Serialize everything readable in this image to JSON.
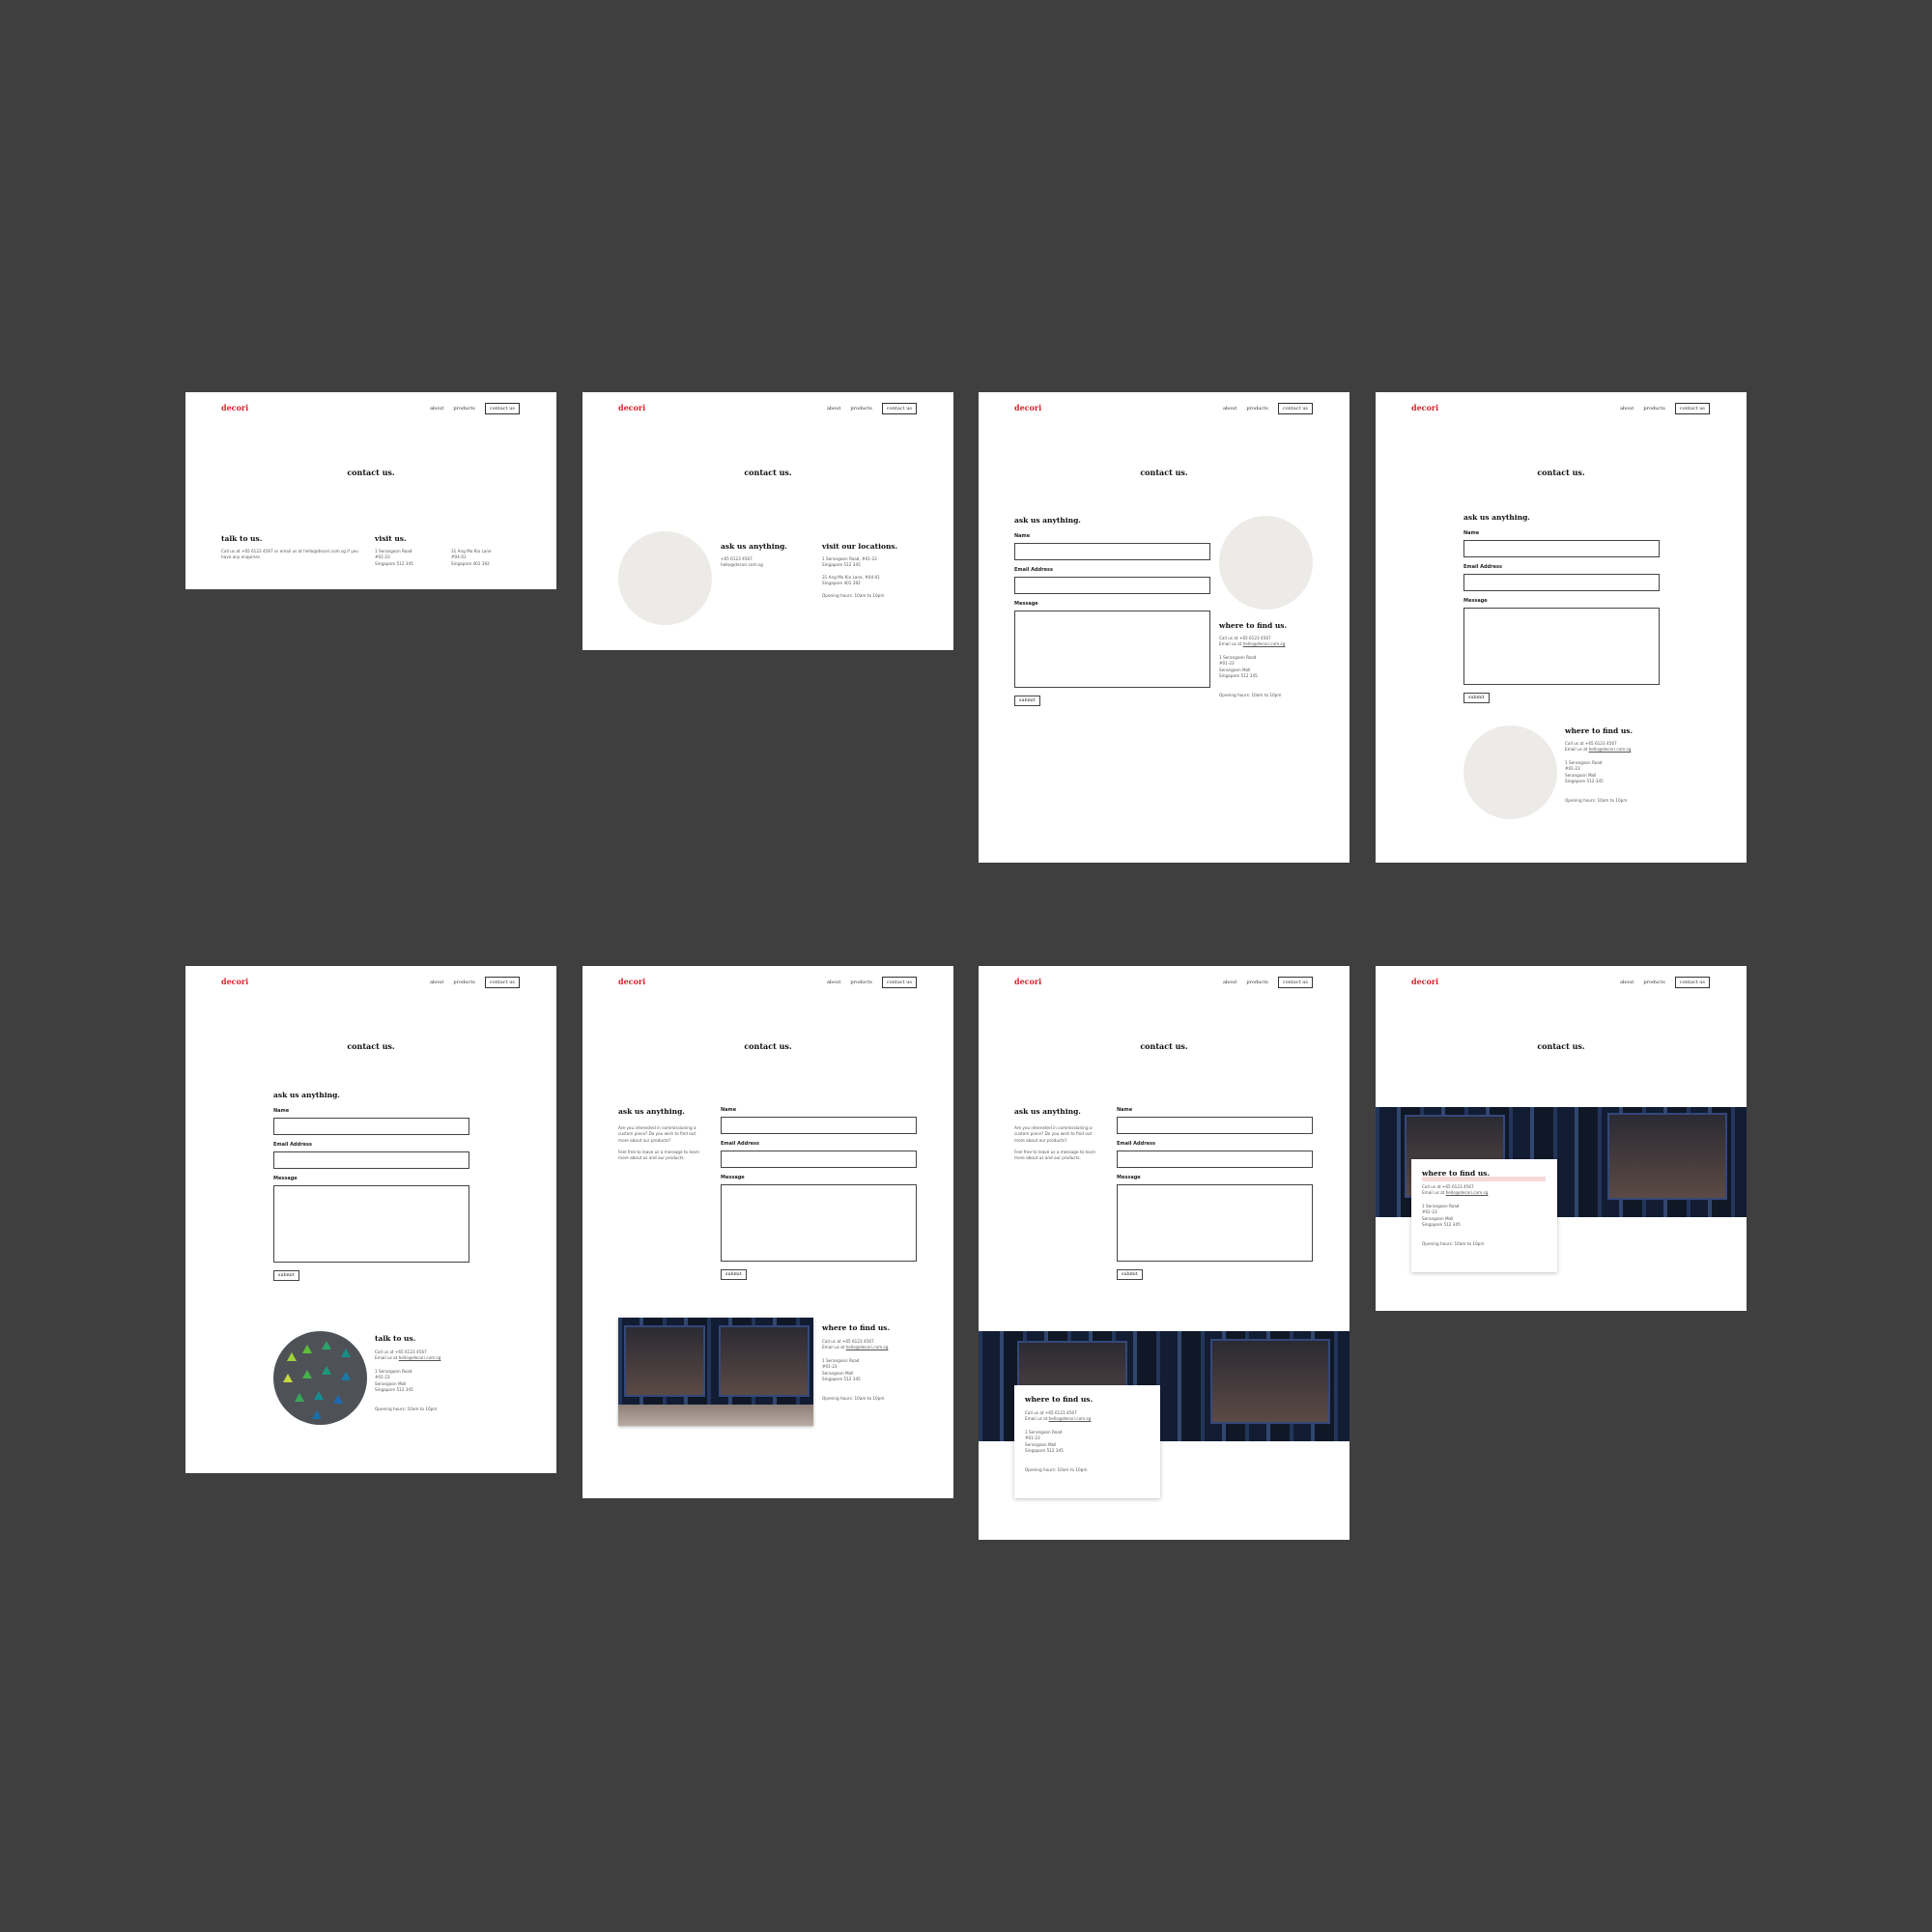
{
  "brand": {
    "logo": "decori",
    "accent_color": "#d9232e"
  },
  "nav": {
    "about": "about",
    "products": "products",
    "contact": "contact us"
  },
  "page_title": "contact us.",
  "form": {
    "heading": "ask us anything.",
    "name_label": "Name",
    "email_label": "Email Address",
    "message_label": "Message",
    "submit_label": "submit",
    "intro": "Are you interested in commissioning a\ncustom piece? Do you wish to find out\nmore about our products?\n\nFeel free to leave us a message to learn\nmore about us and our products."
  },
  "v1": {
    "talk_heading": "talk to us.",
    "talk_text": "Call us at +65 6123 4567 or email us at hello@decori.com.sg if you\nhave any enquiries.",
    "visit_heading": "visit us.",
    "loc1": "1 Serangoon Road\n#01-23\nSingapore 512 345",
    "loc2": "31 Ang Mo Kio Lane\n#04-01\nSingapore 401 392"
  },
  "v2": {
    "ask_heading": "ask us anything.",
    "ask_text": "+65 6123 4567\nhello@decori.com.sg",
    "loc_heading": "visit our locations.",
    "loc_text": "1 Serangoon Road, #01-23\nSingapore 512 345\n\n31 Ang Mo Kio Lane, #04-01\nSingapore 401 392\n\nOpening hours: 10am to 10pm"
  },
  "find": {
    "heading": "where to find us.",
    "call": "Call us at +65 6123 4567",
    "email_prefix": "Email us at ",
    "email": "hello@decori.com.sg",
    "address": "1 Serangoon Road\n#01-23\nSerangoon Mall\nSingapore 512 345",
    "hours": "Opening hours: 10am to 10pm"
  },
  "talk": {
    "heading": "talk to us."
  }
}
